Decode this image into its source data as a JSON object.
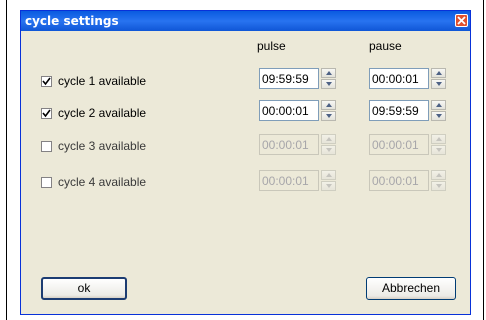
{
  "dialog": {
    "title": "cycle settings",
    "columns": {
      "pulse": "pulse",
      "pause": "pause"
    },
    "rows": [
      {
        "label": "cycle 1 available",
        "checked": true,
        "enabled": true,
        "pulse": "09:59:59",
        "pause": "00:00:01"
      },
      {
        "label": "cycle 2 available",
        "checked": true,
        "enabled": true,
        "pulse": "00:00:01",
        "pause": "09:59:59"
      },
      {
        "label": "cycle 3 available",
        "checked": false,
        "enabled": false,
        "pulse": "00:00:01",
        "pause": "00:00:01"
      },
      {
        "label": "cycle 4 available",
        "checked": false,
        "enabled": false,
        "pulse": "00:00:01",
        "pause": "00:00:01"
      }
    ],
    "buttons": {
      "ok": "ok",
      "cancel": "Abbrechen"
    }
  },
  "colors": {
    "titlebar": "#0a5be0",
    "dialog_bg": "#ece9d8",
    "close": "#e0512f"
  },
  "icons": {
    "close": "close-icon",
    "spin_up": "chevron-up-icon",
    "spin_down": "chevron-down-icon",
    "check": "checkmark-icon"
  }
}
